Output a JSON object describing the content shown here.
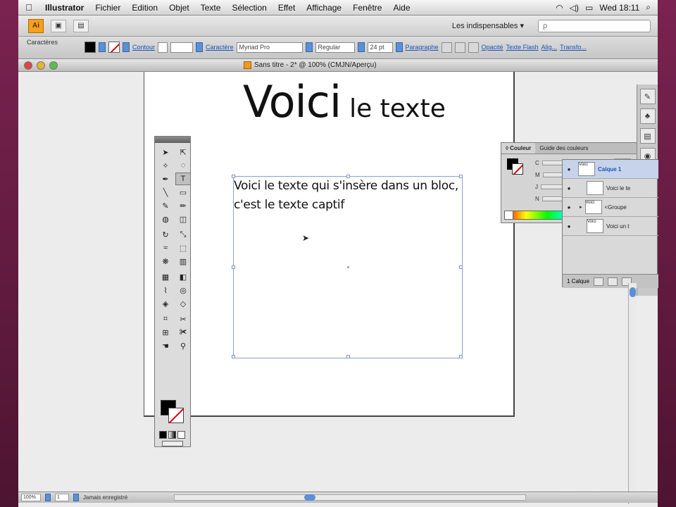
{
  "menubar": {
    "app": "Illustrator",
    "items": [
      "Fichier",
      "Edition",
      "Objet",
      "Texte",
      "Sélection",
      "Effet",
      "Affichage",
      "Fenêtre",
      "Aide"
    ],
    "clock": "Wed 18:11"
  },
  "appbar": {
    "logo": "Ai",
    "workspace": "Les indispensables ▾",
    "search_placeholder": "ρ"
  },
  "controlbar": {
    "caption": "Caractères",
    "contour_label": "Contour",
    "caractere_label": "Caractère",
    "font_value": "Myriad Pro",
    "style_value": "Regular",
    "size_value": "24 pt",
    "paragraphe_label": "Paragraphe",
    "opacite_label": "Opacité",
    "texte_flash_label": "Texte Flash",
    "align_label": "Alig...",
    "transfo_label": "Transfo..."
  },
  "document": {
    "title": "Sans titre - 2* @ 100% (CMJN/Aperçu)",
    "headline_big": "Voici",
    "headline_small": "le texte",
    "frame_text": "Voici le texte qui s'insère dans un bloc, c'est le texte captif"
  },
  "color_panel": {
    "tabs": [
      "◊ Couleur",
      "Guide des couleurs"
    ],
    "channels": [
      "C",
      "M",
      "J",
      "N"
    ],
    "unit": "%"
  },
  "layers_panel": {
    "layers": [
      {
        "name": "Calque 1",
        "thumb": "Voici"
      },
      {
        "name": "Voici le te",
        "thumb": ""
      },
      {
        "name": "<Groupe",
        "thumb": "Voici"
      },
      {
        "name": "Voici un t",
        "thumb": "Voici"
      }
    ],
    "footer": "1 Calque"
  },
  "statusbar": {
    "zoom": "100%",
    "page": "1",
    "info": "Jamais enregistré"
  },
  "colors": {
    "accent_blue": "#5b8fd6",
    "selection_blue": "#8aa3cf",
    "ai_orange": "#f4a21b"
  }
}
